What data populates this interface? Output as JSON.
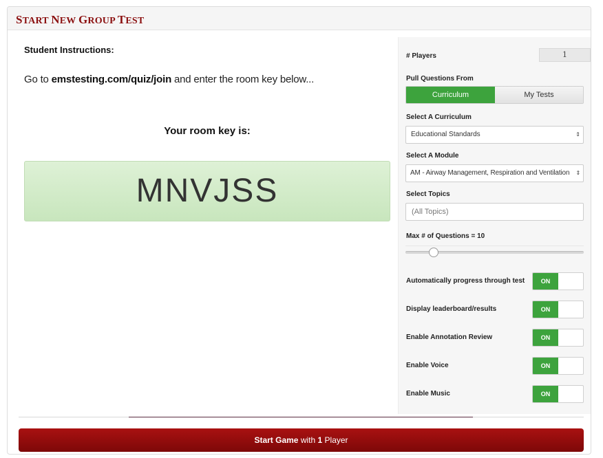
{
  "header": {
    "title_first": "S",
    "title_rest": "TART ",
    "title_n": "N",
    "title_ew": "EW ",
    "title_g": "G",
    "title_roup": "ROUP ",
    "title_t": "T",
    "title_est": "EST"
  },
  "instructions": {
    "heading": "Student Instructions:",
    "prefix": "Go to ",
    "url": "emstesting.com/quiz/join",
    "suffix": " and enter the room key below..."
  },
  "room_key": {
    "label": "Your room key is:",
    "value": "MNVJSS"
  },
  "settings": {
    "players_label": "# Players",
    "players_value": "1",
    "pull_label": "Pull Questions From",
    "pull_options": [
      "Curriculum",
      "My Tests"
    ],
    "pull_selected": "Curriculum",
    "curriculum_label": "Select A Curriculum",
    "curriculum_value": "Educational Standards",
    "module_label": "Select A Module",
    "module_value": "AM - Airway Management, Respiration and Ventilation",
    "topics_label": "Select Topics",
    "topics_placeholder": "(All Topics)",
    "max_questions_label": "Max # of Questions = 10",
    "max_questions_value": 10,
    "toggles": [
      {
        "label": "Automatically progress through test",
        "state": "ON"
      },
      {
        "label": "Display leaderboard/results",
        "state": "ON"
      },
      {
        "label": "Enable Annotation Review",
        "state": "ON"
      },
      {
        "label": "Enable Voice",
        "state": "ON"
      },
      {
        "label": "Enable Music",
        "state": "ON"
      }
    ]
  },
  "start": {
    "bold": "Start Game",
    "mid": " with ",
    "count": "1",
    "tail": " Player"
  },
  "colors": {
    "accent_red": "#8b1010",
    "toggle_green": "#3da33d",
    "button_red": "#9a0e0e"
  },
  "icons": {
    "select_arrow": "updown-arrow-icon"
  }
}
